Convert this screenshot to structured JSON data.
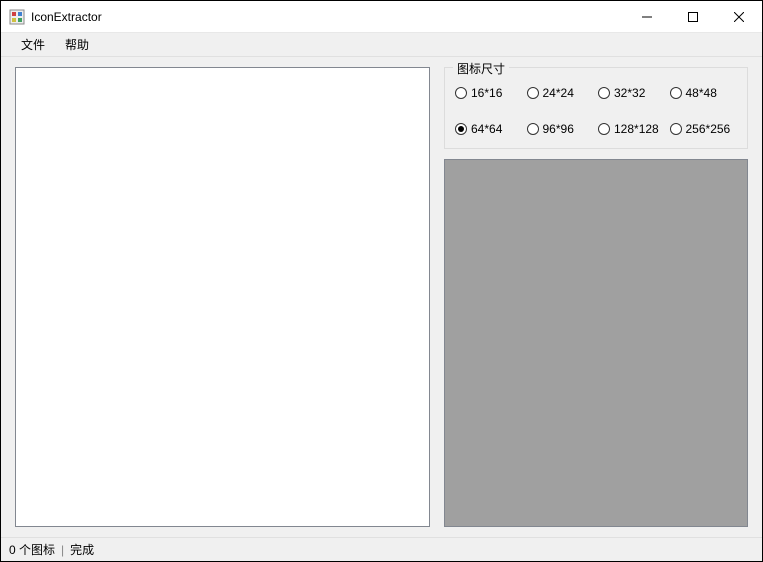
{
  "window": {
    "title": "IconExtractor"
  },
  "menu": {
    "file": "文件",
    "help": "帮助"
  },
  "groupbox": {
    "legend": "图标尺寸"
  },
  "sizes": {
    "s16": "16*16",
    "s24": "24*24",
    "s32": "32*32",
    "s48": "48*48",
    "s64": "64*64",
    "s96": "96*96",
    "s128": "128*128",
    "s256": "256*256",
    "selected": "s64"
  },
  "statusbar": {
    "count": "0 个图标",
    "sep": "|",
    "status": "完成"
  }
}
